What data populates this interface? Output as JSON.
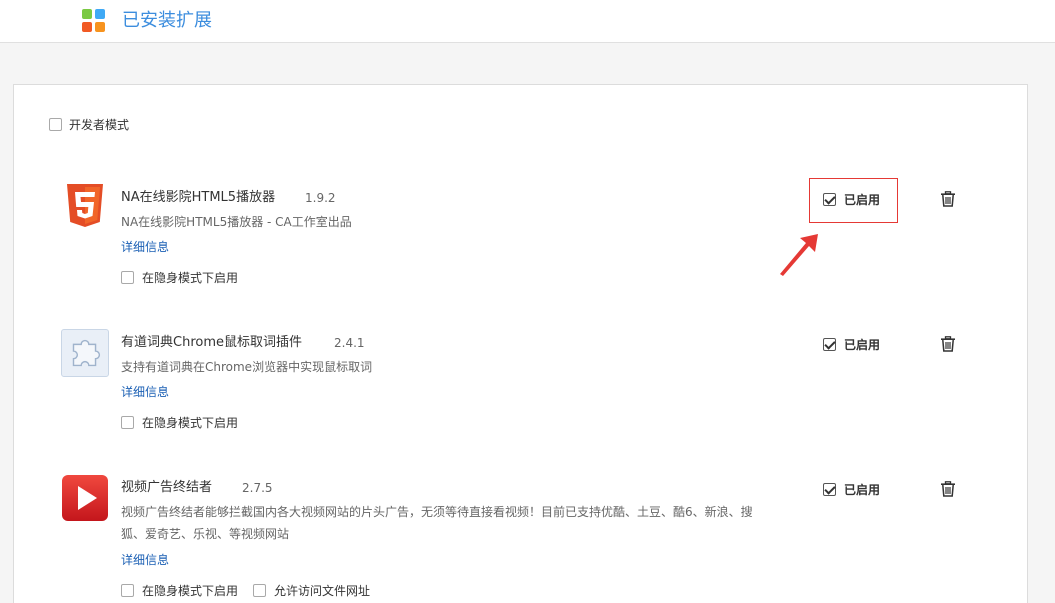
{
  "header": {
    "title": "已安装扩展",
    "logo_colors": [
      "#7ac943",
      "#3fa9f5",
      "#f15a24",
      "#f7931e"
    ]
  },
  "developer_mode": {
    "label": "开发者模式",
    "checked": false
  },
  "extensions": [
    {
      "name": "NA在线影院HTML5播放器",
      "version": "1.9.2",
      "description": "NA在线影院HTML5播放器 - CA工作室出品",
      "details_label": "详细信息",
      "incognito_label": "在隐身模式下启用",
      "enabled_label": "已启用",
      "icon": "html5-icon"
    },
    {
      "name": "有道词典Chrome鼠标取词插件",
      "version": "2.4.1",
      "description": "支持有道词典在Chrome浏览器中实现鼠标取词",
      "details_label": "详细信息",
      "incognito_label": "在隐身模式下启用",
      "enabled_label": "已启用",
      "icon": "puzzle-piece-icon"
    },
    {
      "name": "视频广告终结者",
      "version": "2.7.5",
      "description_line1": "视频广告终结者能够拦截国内各大视频网站的片头广告，无须等待直接看视频！目前已支持优酷、土豆、酷6、新浪、搜",
      "description_line2": "狐、爱奇艺、乐视、等视频网站",
      "details_label": "详细信息",
      "incognito_label": "在隐身模式下启用",
      "file_access_label": "允许访问文件网址",
      "enabled_label": "已启用",
      "icon": "play-button-icon"
    }
  ],
  "accent_colors": {
    "title_blue": "#3c8dde",
    "link_blue": "#1a5fb4",
    "annotation_red": "#e53935"
  }
}
